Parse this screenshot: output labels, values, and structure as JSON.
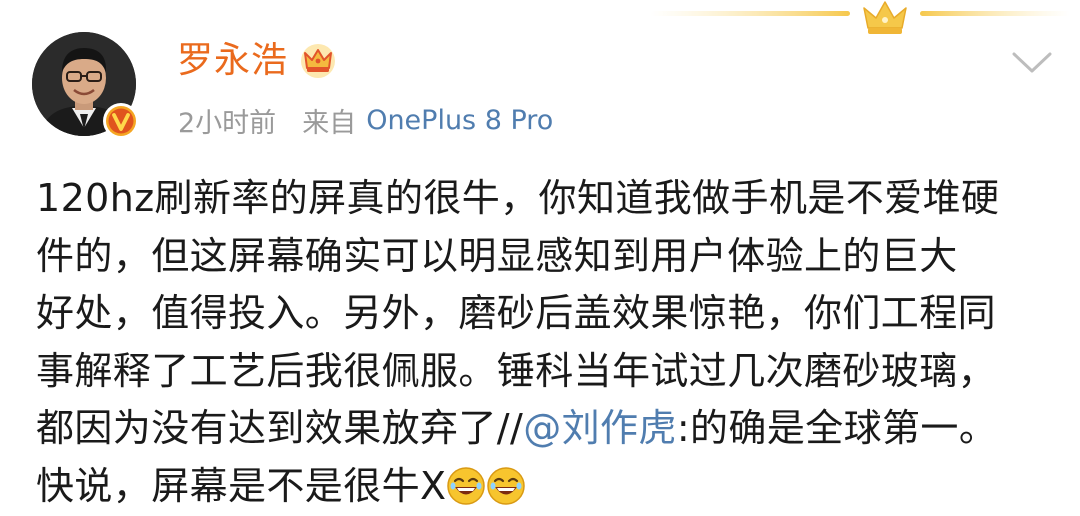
{
  "post": {
    "author": {
      "name": "罗永浩",
      "avatar_icon": "user-avatar-photo",
      "verified_badge_icon": "verified-v-icon",
      "member_icon": "crown-icon"
    },
    "meta": {
      "time": "2小时前",
      "from_label": "来自",
      "device": "OnePlus 8 Pro"
    },
    "lines": [
      "120hz刷新率的屏真的很牛，你知道我做手机是不爱堆硬",
      "件的，但这屏幕确实可以明显感知到用户体验上的巨大",
      "好处，值得投入。另外，磨砂后盖效果惊艳，你们工程同",
      "事解释了工艺后我很佩服。锤科当年试过几次磨砂玻璃，"
    ],
    "line5": {
      "before": "都因为没有达到效果放弃了//",
      "mention": "@刘作虎",
      "after": ":的确是全球第一。"
    },
    "line6": {
      "text": "快说，屏幕是不是很牛X",
      "emoji_icon": "laughing-emoji-icon"
    }
  },
  "colors": {
    "username": "#ea6a1d",
    "link": "#507daf",
    "meta": "#9a9a9a",
    "body_text": "#1a1a1a",
    "gold": "#f3c34a"
  },
  "icons": {
    "dropdown": "chevron-down-icon",
    "decoration": "gold-crown-streak-icon"
  }
}
